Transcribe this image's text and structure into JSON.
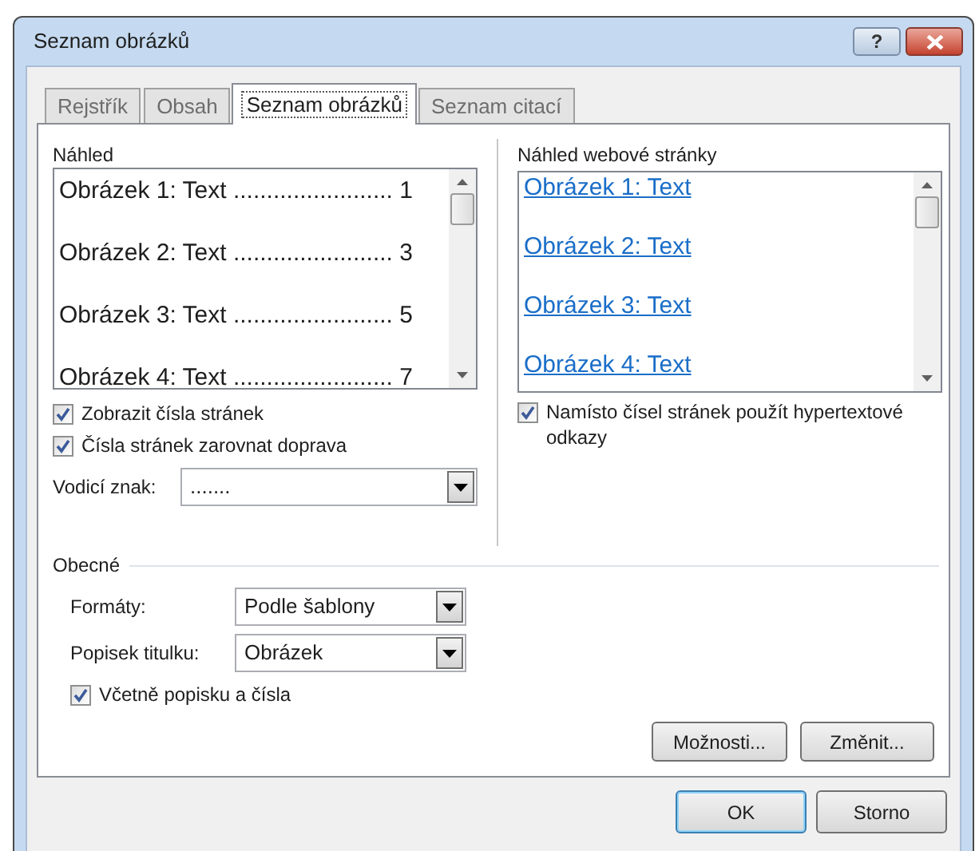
{
  "window": {
    "title": "Seznam obrázků"
  },
  "title_buttons": [
    {
      "kind": "help",
      "label": "?"
    },
    {
      "kind": "close"
    }
  ],
  "tabs": [
    {
      "label": "Rejstřík",
      "selected": false
    },
    {
      "label": "Obsah",
      "selected": false
    },
    {
      "label": "Seznam obrázků",
      "selected": true
    },
    {
      "label": "Seznam citací",
      "selected": false
    }
  ],
  "preview": {
    "label": "Náhled",
    "entries": [
      "Obrázek 1: Text ........................ 1",
      "Obrázek 2: Text ........................ 3",
      "Obrázek 3: Text ........................ 5",
      "Obrázek 4: Text ........................ 7"
    ]
  },
  "show_page_numbers": {
    "label": "Zobrazit čísla stránek",
    "checked": true
  },
  "right_align": {
    "label": "Čísla stránek zarovnat doprava",
    "checked": true
  },
  "tab_leader": {
    "label": "Vodicí znak:",
    "value": "......."
  },
  "web_preview": {
    "label": "Náhled webové stránky",
    "links": [
      "Obrázek 1: Text",
      "Obrázek 2: Text",
      "Obrázek 3: Text",
      "Obrázek 4: Text"
    ]
  },
  "use_hyperlinks": {
    "label": "Namísto čísel stránek použít hypertextové odkazy",
    "checked": true
  },
  "general": {
    "title": "Obecné",
    "formats": {
      "label": "Formáty:",
      "value": "Podle šablony"
    },
    "caption_label": {
      "label": "Popisek titulku:",
      "value": "Obrázek"
    },
    "include_label": {
      "label": "Včetně popisku a čísla",
      "checked": true
    },
    "buttons": [
      "Možnosti...",
      "Změnit..."
    ]
  },
  "buttons": [
    {
      "label": "OK",
      "default": true
    },
    {
      "label": "Storno",
      "default": false
    }
  ]
}
